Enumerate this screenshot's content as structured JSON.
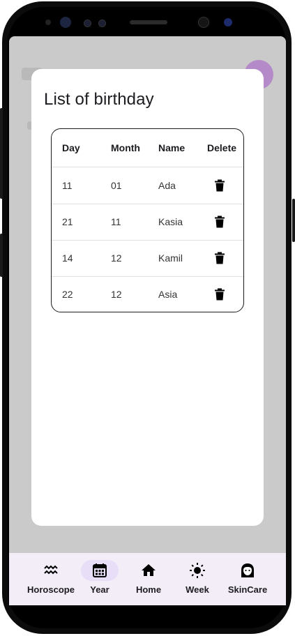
{
  "dialog": {
    "title": "List of birthday",
    "columns": [
      "Day",
      "Month",
      "Name",
      "Delete"
    ],
    "rows": [
      {
        "day": "11",
        "month": "01",
        "name": "Ada"
      },
      {
        "day": "21",
        "month": "11",
        "name": "Kasia"
      },
      {
        "day": "14",
        "month": "12",
        "name": "Kamil"
      },
      {
        "day": "22",
        "month": "12",
        "name": "Asia"
      }
    ],
    "delete_icon": "trash-icon"
  },
  "nav": {
    "items": [
      {
        "label": "Horoscope",
        "icon": "waves-icon",
        "active": false
      },
      {
        "label": "Year",
        "icon": "calendar-icon",
        "active": true
      },
      {
        "label": "Home",
        "icon": "home-icon",
        "active": false
      },
      {
        "label": "Week",
        "icon": "sun-icon",
        "active": false
      },
      {
        "label": "SkinCare",
        "icon": "face-icon",
        "active": false
      }
    ]
  },
  "colors": {
    "scrim": "#cacaca",
    "navbar_bg": "#f3edf7",
    "active_pill": "#e8def8",
    "avatar": "#b48ac9"
  }
}
